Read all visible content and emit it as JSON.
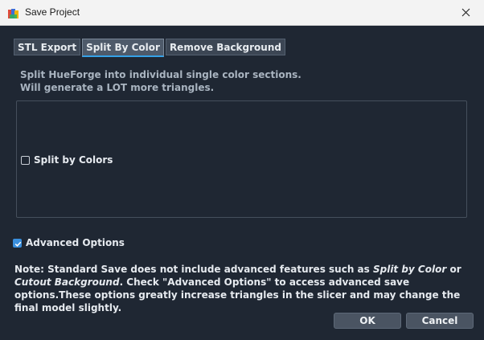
{
  "window": {
    "title": "Save Project",
    "close_icon": "close-icon",
    "app_icon": "app-icon"
  },
  "tabs": [
    {
      "label": "STL Export",
      "active": false
    },
    {
      "label": "Split By Color",
      "active": true
    },
    {
      "label": "Remove Background",
      "active": false
    }
  ],
  "split_tab": {
    "description_line1": "Split HueForge into individual single color sections.",
    "description_line2": "Will generate a LOT more triangles.",
    "split_checkbox": {
      "label": "Split by Colors",
      "checked": false
    }
  },
  "advanced": {
    "label": "Advanced Options",
    "checked": true
  },
  "note": {
    "part1": "Note: Standard Save does not include advanced features such as ",
    "em1": "Split by Color",
    "part2": " or ",
    "em2": "Cutout Background",
    "part3": ". Check \"Advanced Options\" to access advanced save options.These options greatly increase triangles in the slicer and may change the final model slightly."
  },
  "buttons": {
    "ok": "OK",
    "cancel": "Cancel"
  },
  "colors": {
    "background": "#1f2733",
    "accent": "#35a2e8",
    "checkbox_checked": "#3a8fdd"
  }
}
